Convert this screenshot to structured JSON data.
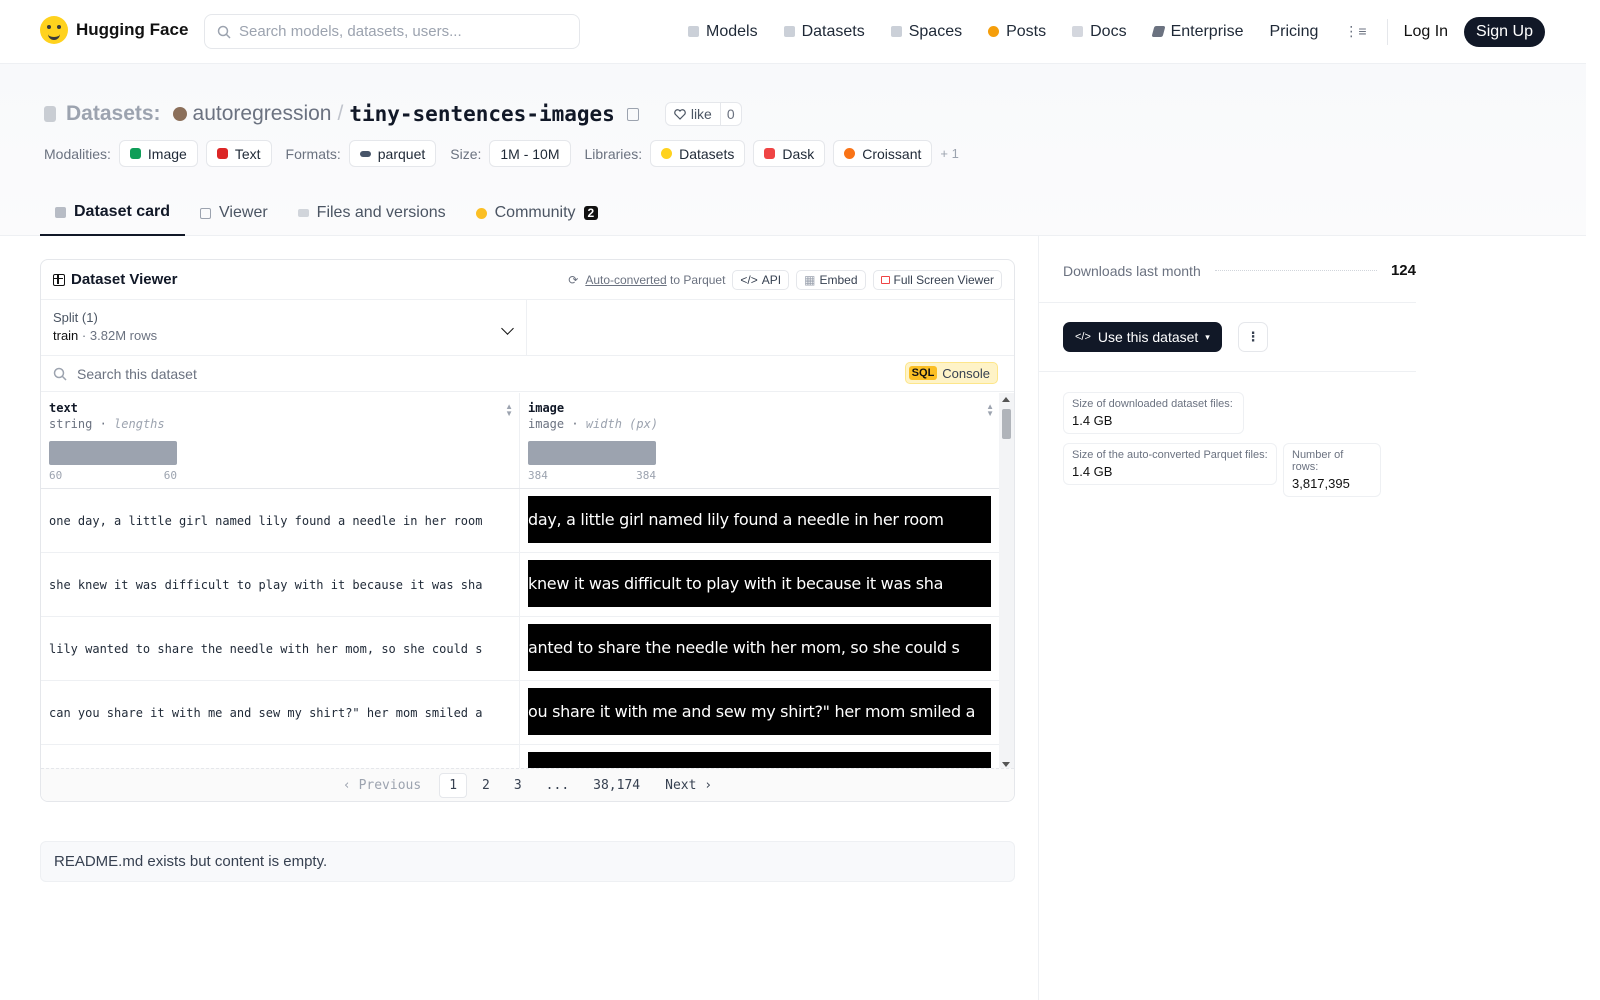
{
  "nav": {
    "brand": "Hugging Face",
    "search_placeholder": "Search models, datasets, users...",
    "items": [
      "Models",
      "Datasets",
      "Spaces",
      "Posts",
      "Docs",
      "Enterprise"
    ],
    "pricing": "Pricing",
    "login": "Log In",
    "signup": "Sign Up"
  },
  "header": {
    "prefix": "Datasets:",
    "owner": "autoregression",
    "separator": "/",
    "name": "tiny-sentences-images",
    "like_label": "like",
    "like_count": "0",
    "modalities_label": "Modalities:",
    "modalities": [
      "Image",
      "Text"
    ],
    "formats_label": "Formats:",
    "format": "parquet",
    "size_label": "Size:",
    "size": "1M - 10M",
    "libraries_label": "Libraries:",
    "libraries": [
      "Datasets",
      "Dask",
      "Croissant"
    ],
    "libraries_more": "+ 1"
  },
  "tabs": [
    {
      "label": "Dataset card"
    },
    {
      "label": "Viewer"
    },
    {
      "label": "Files and versions"
    },
    {
      "label": "Community",
      "badge": "2"
    }
  ],
  "viewer": {
    "title": "Dataset Viewer",
    "auto_converted": "Auto-converted",
    "to_parquet": "to Parquet",
    "api": "API",
    "embed": "Embed",
    "fullscreen": "Full Screen Viewer",
    "split_label": "Split (1)",
    "split_name": "train",
    "split_sep": "·",
    "split_rows": "3.82M rows",
    "search_placeholder": "Search this dataset",
    "sql": "SQL",
    "console": "Console",
    "columns": [
      {
        "name": "text",
        "type": "string",
        "stat": "lengths",
        "min": "60",
        "max": "60"
      },
      {
        "name": "image",
        "type": "image",
        "stat": "width (px)",
        "min": "384",
        "max": "384"
      }
    ],
    "rows": [
      {
        "text": "one day, a little girl named lily found a needle in her room",
        "image_text": "day, a little girl named lily found a needle in her room"
      },
      {
        "text": "she knew it was difficult to play with it because it was sha",
        "image_text": "knew it was difficult to play with it because it was sha"
      },
      {
        "text": "lily wanted to share the needle with her mom, so she could s",
        "image_text": "anted to share the needle with her mom, so she could s"
      },
      {
        "text": "can you share it with me and sew my shirt?\" her mom smiled a",
        "image_text": "ou share it with me and sew my shirt?\" her mom smiled a"
      },
      {
        "text": "",
        "image_text": ""
      }
    ],
    "pager": {
      "previous": "Previous",
      "pages": [
        "1",
        "2",
        "3",
        "...",
        "38,174"
      ],
      "next": "Next"
    }
  },
  "readme": "README.md exists but content is empty.",
  "sidebar": {
    "downloads_label": "Downloads last month",
    "downloads": "124",
    "use_button": "Use this dataset",
    "download_size_label": "Size of downloaded dataset files:",
    "download_size": "1.4 GB",
    "parquet_size_label": "Size of the auto-converted Parquet files:",
    "parquet_size": "1.4 GB",
    "rows_label": "Number of rows:",
    "rows": "3,817,395"
  }
}
